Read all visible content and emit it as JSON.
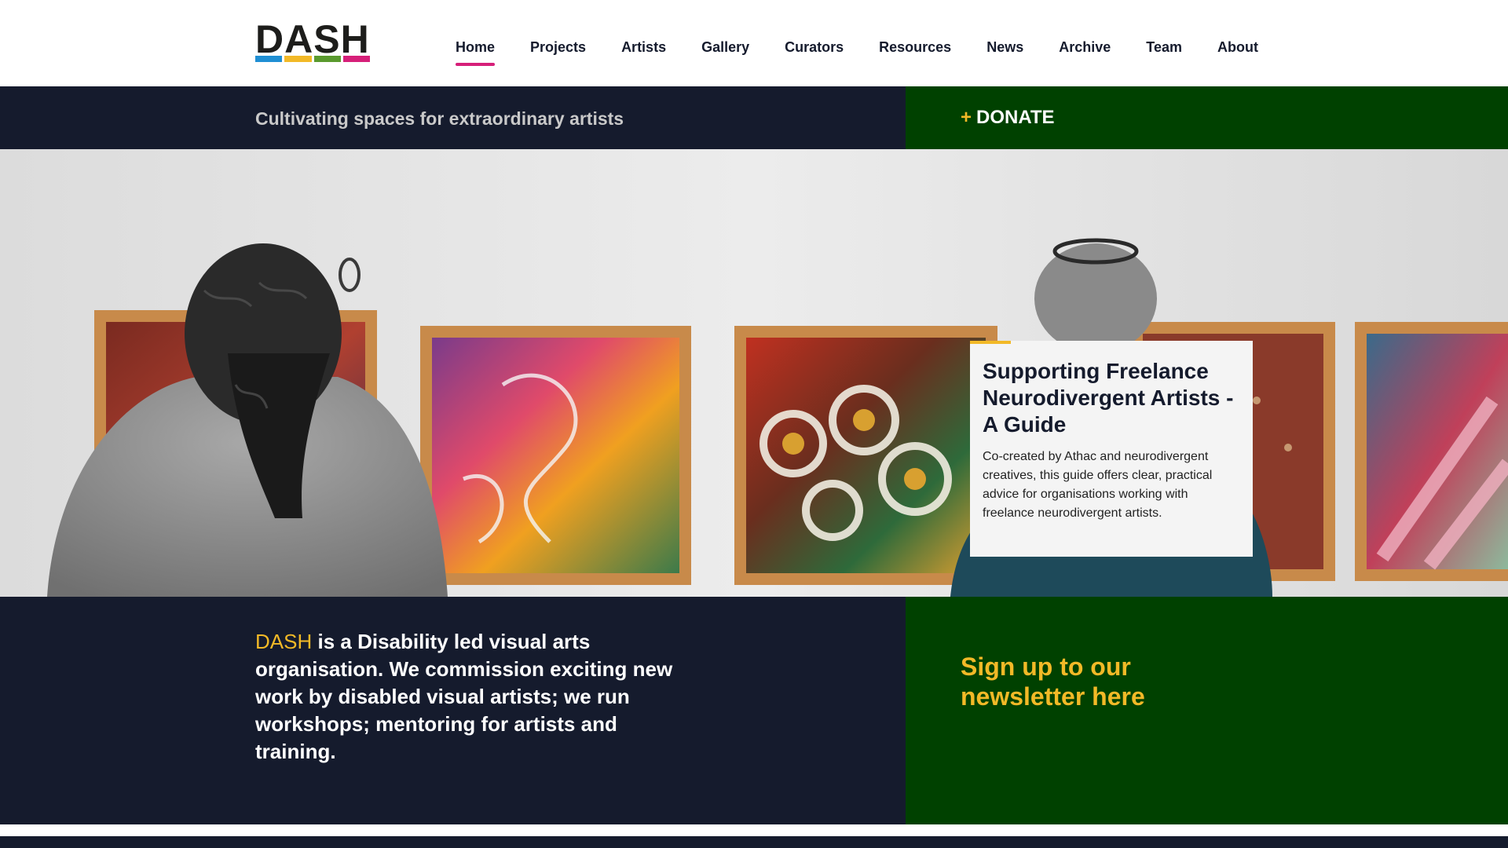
{
  "logo": {
    "text": "DASH",
    "bar_colors": [
      "#1f8fd3",
      "#f2b927",
      "#5a9a2e",
      "#d61f79"
    ]
  },
  "nav": {
    "items": [
      {
        "label": "Home",
        "active": true
      },
      {
        "label": "Projects",
        "active": false
      },
      {
        "label": "Artists",
        "active": false
      },
      {
        "label": "Gallery",
        "active": false
      },
      {
        "label": "Curators",
        "active": false
      },
      {
        "label": "Resources",
        "active": false
      },
      {
        "label": "News",
        "active": false
      },
      {
        "label": "Archive",
        "active": false
      },
      {
        "label": "Team",
        "active": false
      },
      {
        "label": "About",
        "active": false
      }
    ]
  },
  "tagline": "Cultivating spaces for extraordinary artists",
  "donate": {
    "plus": "+",
    "label": "DONATE"
  },
  "feature": {
    "title": "Supporting Freelance Neurodivergent Artists - A Guide",
    "text": "Co-created by Athac and neurodivergent creatives, this guide offers clear, practical advice for organisations working with freelance neurodivergent artists."
  },
  "intro": {
    "brand": "DASH",
    "text": " is a Disability led visual arts organisation. We commission exciting new work by disabled visual artists; we run workshops; mentoring for artists and training."
  },
  "newsletter": {
    "label": "Sign up to our newsletter here"
  },
  "colors": {
    "navy": "#151b2d",
    "green": "#004100",
    "yellow": "#f2b927",
    "pink": "#d61f79"
  }
}
